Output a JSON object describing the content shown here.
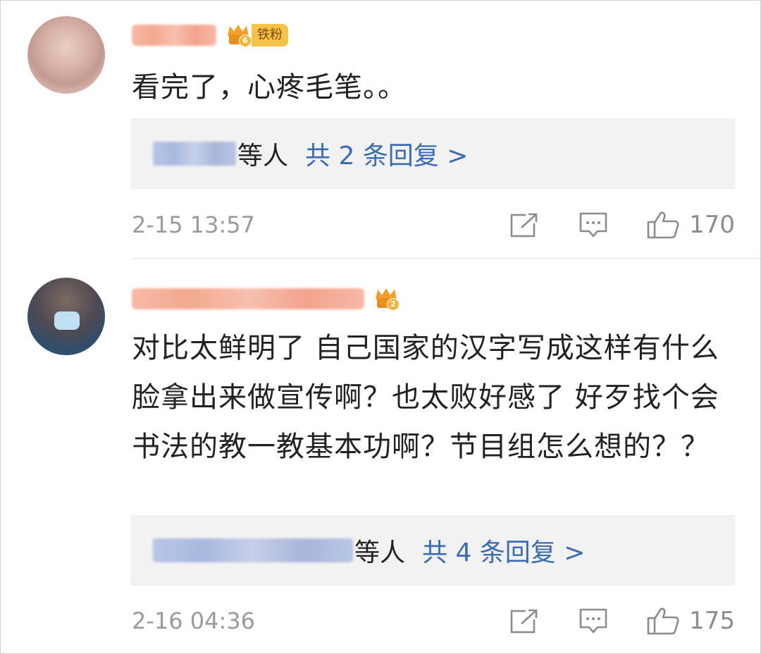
{
  "comments": [
    {
      "fan_badge_level": "6",
      "fan_badge_label": "铁粉",
      "text": "看完了，心疼毛笔。。",
      "reply_etc": "等人",
      "reply_link": "共 2 条回复 >",
      "time": "2-15 13:57",
      "likes": "170"
    },
    {
      "fan_badge_level": "2",
      "text": "对比太鲜明了 自己国家的汉字写成这样有什么脸拿出来做宣传啊？也太败好感了 好歹找个会书法的教一教基本功啊？节目组怎么想的？？",
      "reply_etc": "等人",
      "reply_link": "共 4 条回复 >",
      "time": "2-16 04:36",
      "likes": "175"
    }
  ],
  "icons": {
    "share": "share-icon",
    "comment": "comment-icon",
    "like": "thumbs-up-icon"
  },
  "colors": {
    "link": "#3b6bb3",
    "meta": "#9a9a9a",
    "reply_bg": "#f2f2f2",
    "badge": "#f7c24a"
  }
}
